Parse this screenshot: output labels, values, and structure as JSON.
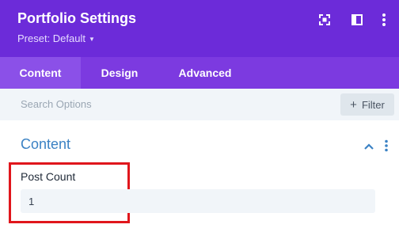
{
  "header": {
    "title": "Portfolio Settings",
    "preset_label": "Preset: Default",
    "icons": [
      "expand-icon",
      "sidebar-toggle-icon",
      "more-vertical-icon"
    ]
  },
  "tabs": [
    {
      "label": "Content",
      "active": true
    },
    {
      "label": "Design",
      "active": false
    },
    {
      "label": "Advanced",
      "active": false
    }
  ],
  "search": {
    "placeholder": "Search Options",
    "filter_label": "Filter"
  },
  "section": {
    "title": "Content"
  },
  "field": {
    "label": "Post Count",
    "value": "1"
  },
  "colors": {
    "header_bg": "#6c2bd9",
    "tab_bar_bg": "#7c3ae0",
    "active_tab_bg": "#8b50e8",
    "section_title": "#3b82c4",
    "highlight_border": "#e0161c"
  }
}
